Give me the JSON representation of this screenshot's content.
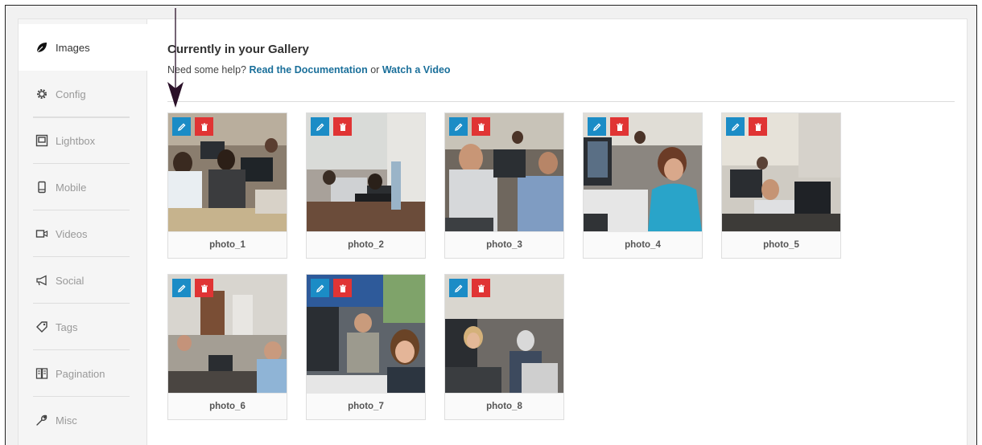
{
  "sidebar": {
    "items": [
      {
        "label": "Images",
        "icon": "leaf-icon",
        "active": true
      },
      {
        "label": "Config",
        "icon": "gear-icon"
      },
      {
        "label": "Lightbox",
        "icon": "lightbox-icon"
      },
      {
        "label": "Mobile",
        "icon": "mobile-icon"
      },
      {
        "label": "Videos",
        "icon": "video-icon"
      },
      {
        "label": "Social",
        "icon": "megaphone-icon"
      },
      {
        "label": "Tags",
        "icon": "tag-icon"
      },
      {
        "label": "Pagination",
        "icon": "pagination-icon"
      },
      {
        "label": "Misc",
        "icon": "wrench-icon"
      }
    ]
  },
  "main": {
    "title": "Currently in your Gallery",
    "help_prefix": "Need some help?",
    "docs_link": "Read the Documentation",
    "help_or": "or",
    "video_link": "Watch a Video"
  },
  "gallery": {
    "photos": [
      {
        "caption": "photo_1"
      },
      {
        "caption": "photo_2"
      },
      {
        "caption": "photo_3"
      },
      {
        "caption": "photo_4"
      },
      {
        "caption": "photo_5"
      },
      {
        "caption": "photo_6"
      },
      {
        "caption": "photo_7"
      },
      {
        "caption": "photo_8"
      }
    ]
  },
  "colors": {
    "edit_button": "#1b8cc6",
    "delete_button": "#e03434",
    "link": "#1a6f9a"
  }
}
